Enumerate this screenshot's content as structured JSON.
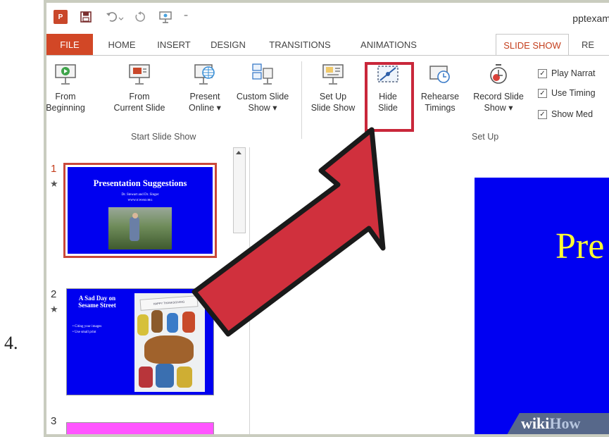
{
  "step_number": "4.",
  "window": {
    "app_icon_text": "P",
    "document_title": "pptexam"
  },
  "tabs": [
    "FILE",
    "HOME",
    "INSERT",
    "DESIGN",
    "TRANSITIONS",
    "ANIMATIONS",
    "SLIDE SHOW",
    "RE"
  ],
  "active_tab": "SLIDE SHOW",
  "ribbon": {
    "start_group": {
      "label": "Start Slide Show",
      "from_beginning": [
        "From",
        "Beginning"
      ],
      "from_current": [
        "From",
        "Current Slide"
      ],
      "present_online": [
        "Present",
        "Online ▾"
      ],
      "custom_show": [
        "Custom Slide",
        "Show ▾"
      ]
    },
    "setup_group": {
      "label": "Set Up",
      "setup_show": [
        "Set Up",
        "Slide Show"
      ],
      "hide_slide": [
        "Hide",
        "Slide"
      ],
      "rehearse": [
        "Rehearse",
        "Timings"
      ],
      "record": [
        "Record Slide",
        "Show ▾"
      ]
    },
    "checkboxes": [
      "Play Narrat",
      "Use Timing",
      "Show Med"
    ]
  },
  "slides": [
    {
      "number": "1",
      "title": "Presentation Suggestions",
      "subtitle": "Dr. Stewart and Dr. Singer",
      "subtitle2": "WWW.ICWSM.ORG",
      "selected": true
    },
    {
      "number": "2",
      "title": "A Sad Day on Sesame Street",
      "bullets": [
        "Citing your images",
        "Use small print"
      ],
      "banner": "HAPPY THANKSGIVING",
      "selected": false
    },
    {
      "number": "3",
      "selected": false
    }
  ],
  "main_slide": {
    "title_visible": "Pre"
  },
  "watermark": {
    "wiki": "wiki",
    "how": "How"
  },
  "colors": {
    "file_tab": "#d24726",
    "active_tab_text": "#c43e1c",
    "highlight": "#c9273a",
    "slide_bg": "#0000f0",
    "slide_title": "#ffff33",
    "slide3_bg": "#ff66ff"
  }
}
